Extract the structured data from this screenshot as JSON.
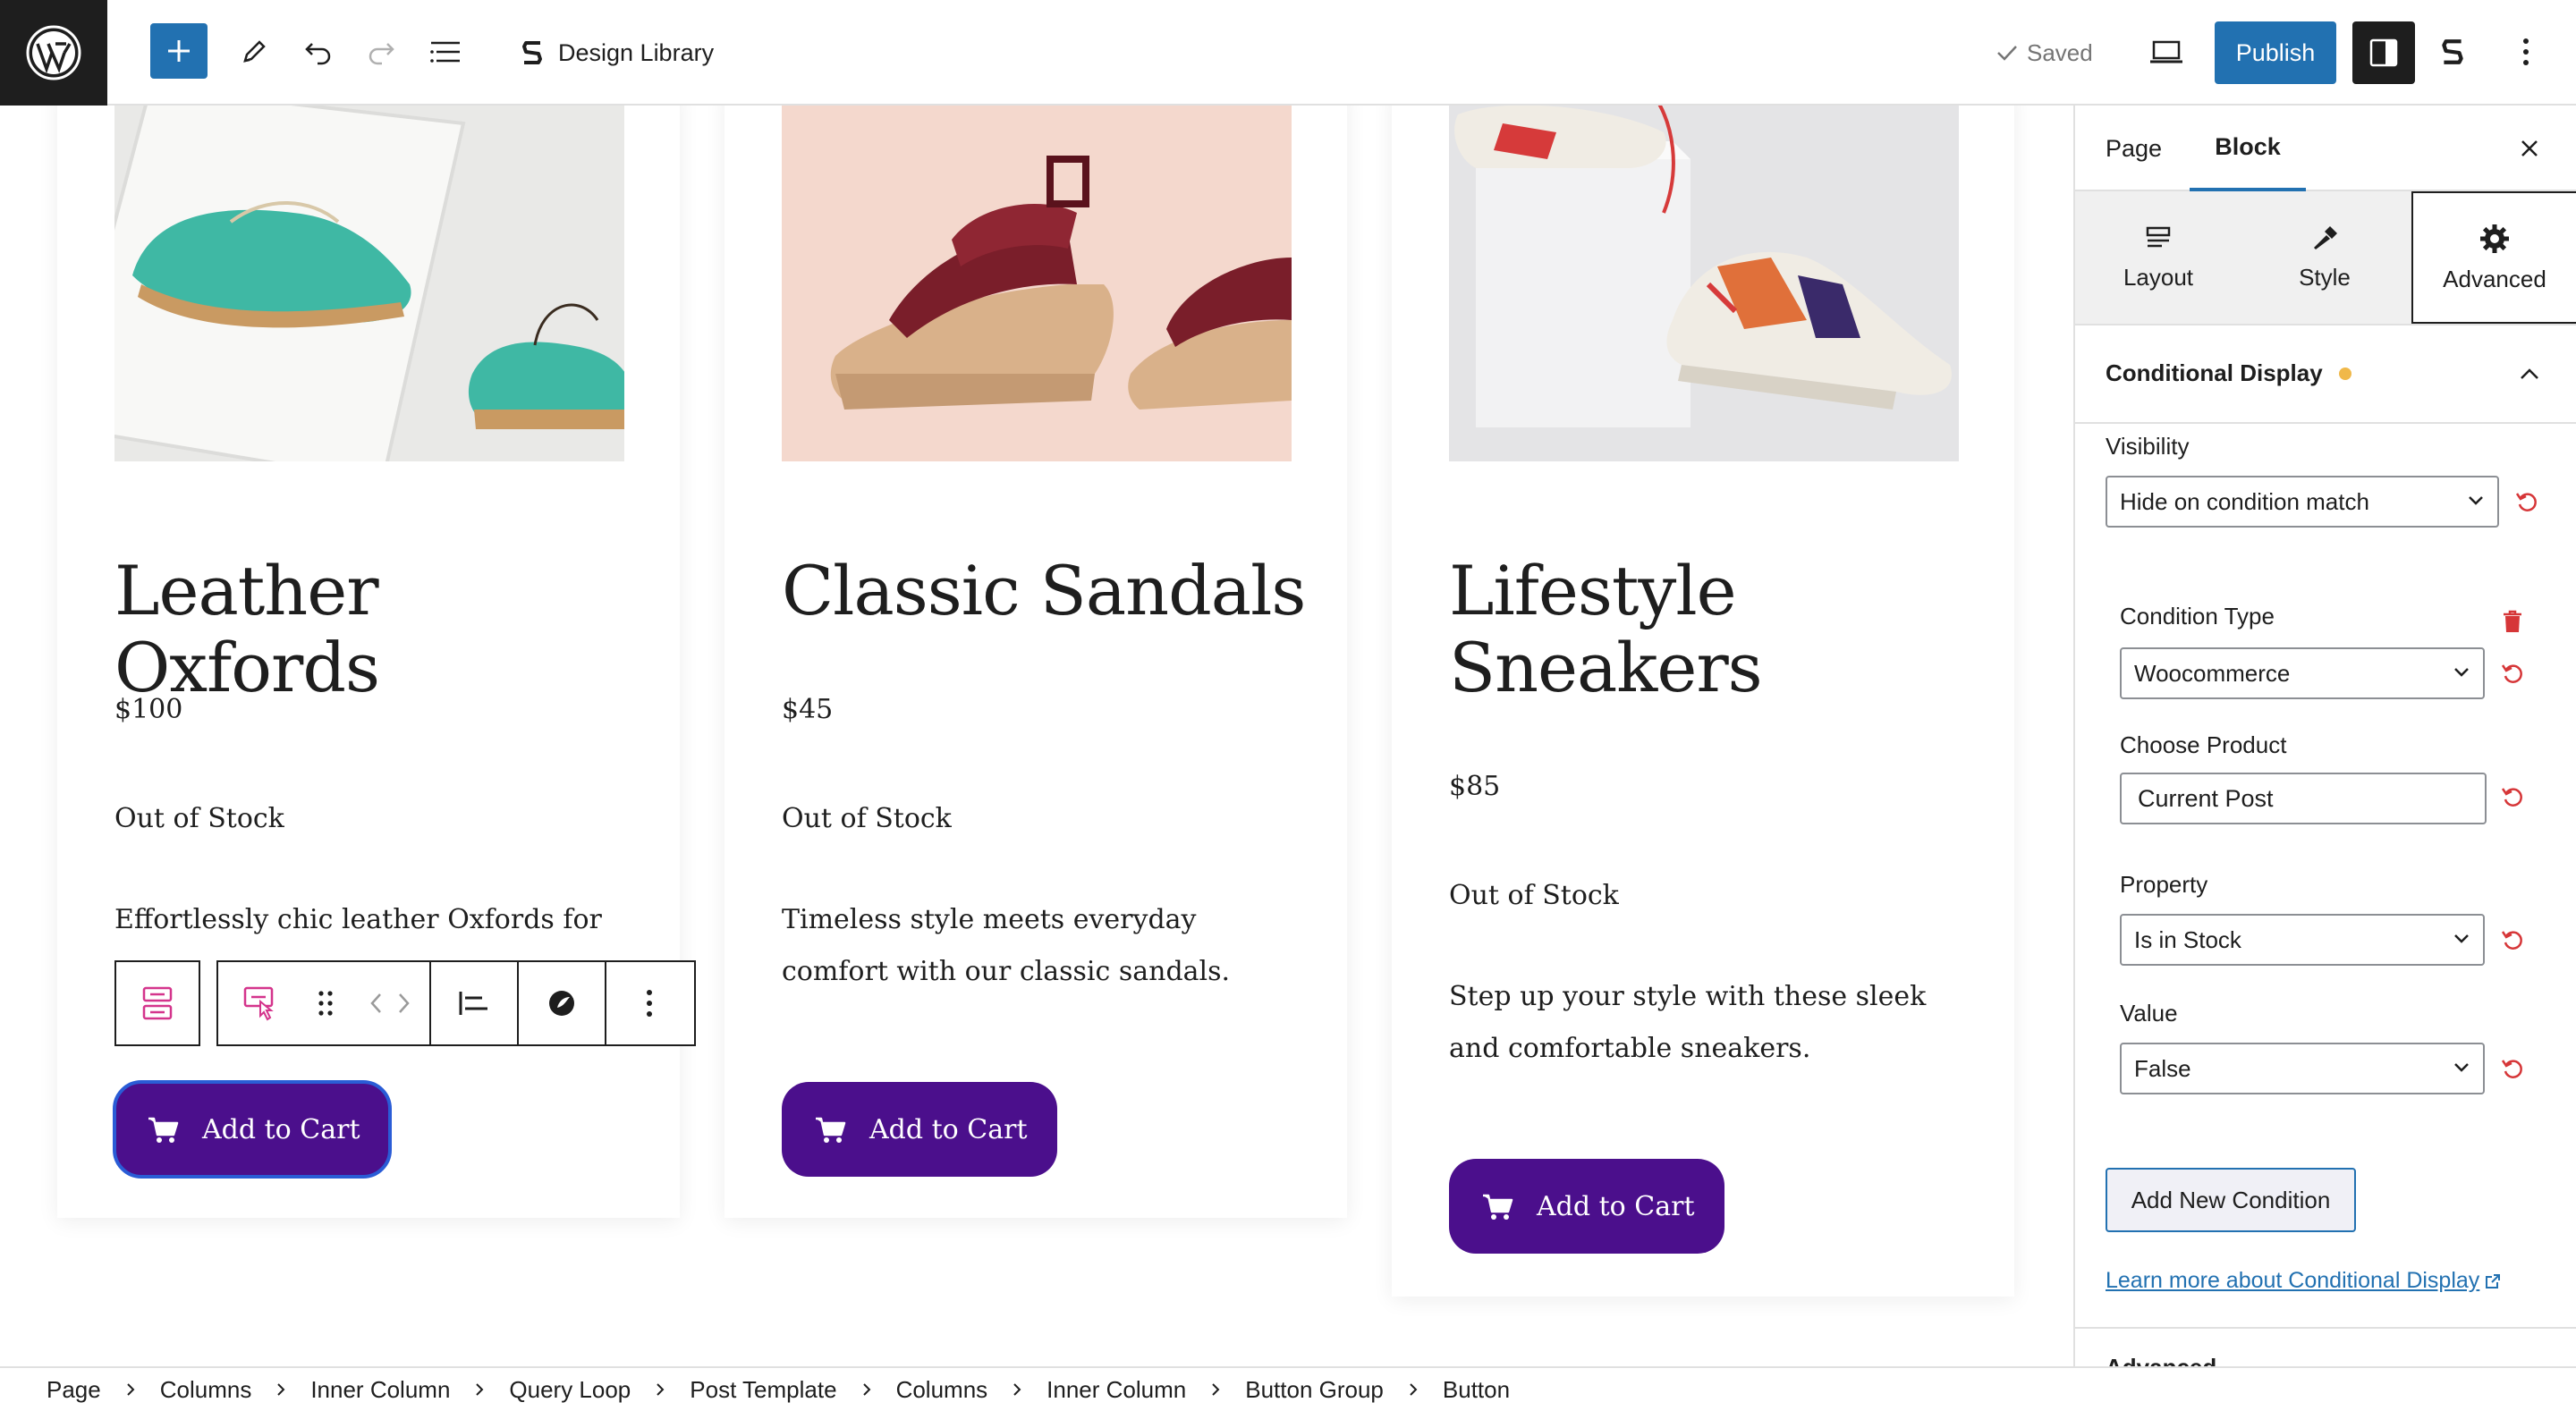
{
  "header": {
    "site_title": "Design Library",
    "saved_label": "Saved",
    "publish_label": "Publish"
  },
  "products": [
    {
      "title": "Leather Oxfords",
      "price": "$100",
      "stock": "Out of Stock",
      "description": "Effortlessly chic leather Oxfords for",
      "button": "Add to Cart"
    },
    {
      "title": "Classic Sandals",
      "price": "$45",
      "stock": "Out of Stock",
      "description": "Timeless style meets everyday comfort with our classic sandals.",
      "button": "Add to Cart"
    },
    {
      "title": "Lifestyle Sneakers",
      "price": "$85",
      "stock": "Out of Stock",
      "description": "Step up your style with these sleek and comfortable sneakers.",
      "button": "Add to Cart"
    }
  ],
  "sidebar": {
    "tabs": [
      "Page",
      "Block"
    ],
    "subtabs": [
      "Layout",
      "Style",
      "Advanced"
    ],
    "panel_title": "Conditional Display",
    "visibility_label": "Visibility",
    "visibility_value": "Hide on condition match",
    "condition_type_label": "Condition Type",
    "condition_type_value": "Woocommerce",
    "choose_product_label": "Choose Product",
    "choose_product_value": "Current Post",
    "property_label": "Property",
    "property_value": "Is in Stock",
    "value_label": "Value",
    "value_value": "False",
    "add_condition_label": "Add New Condition",
    "learn_more_label": "Learn more about Conditional Display",
    "next_panel_label": "Advanced"
  },
  "breadcrumb": [
    "Page",
    "Columns",
    "Inner Column",
    "Query Loop",
    "Post Template",
    "Columns",
    "Inner Column",
    "Button Group",
    "Button"
  ],
  "colors": {
    "accent": "#2271b1",
    "button_purple": "#4b0f8c",
    "reset_red": "#d63638",
    "status_dot": "#f0b849"
  }
}
